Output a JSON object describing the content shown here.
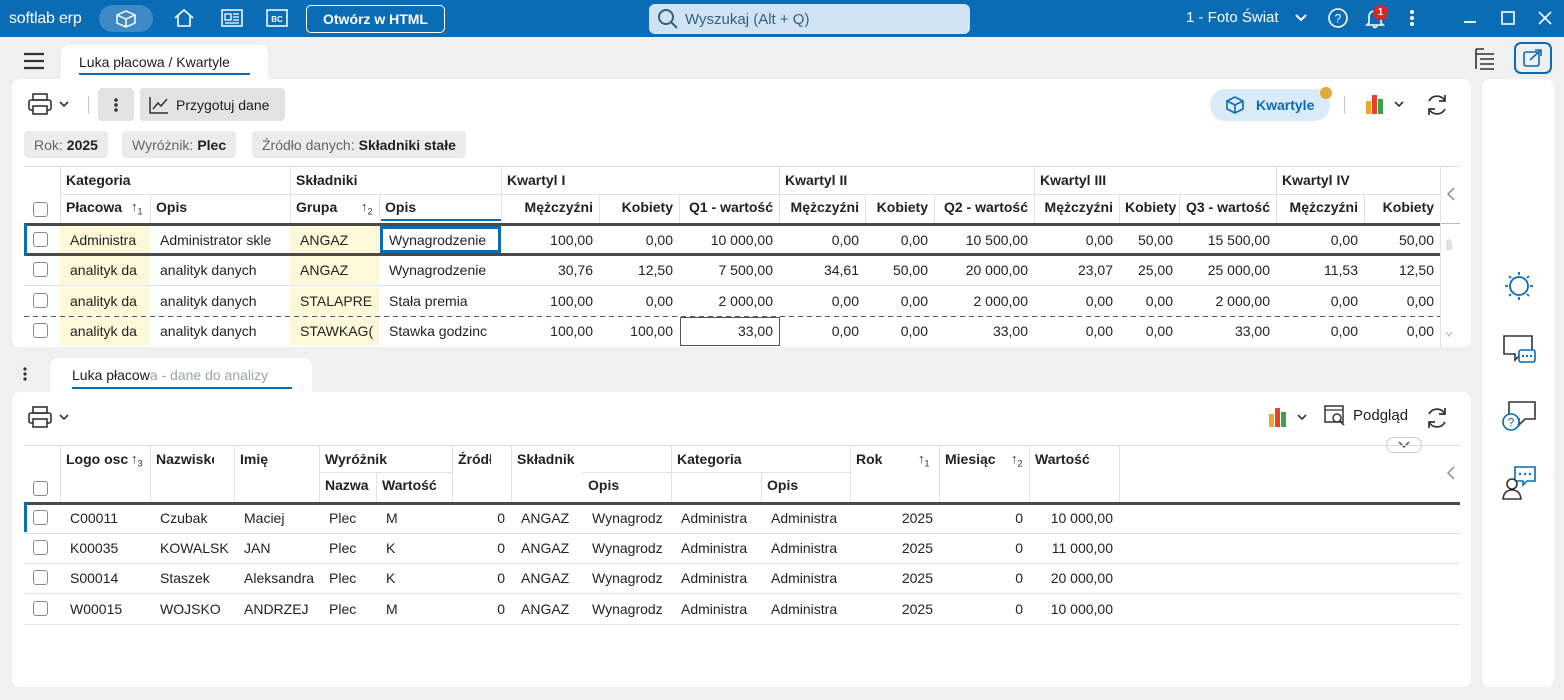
{
  "app": {
    "brand": "softlab erp",
    "open_html_label": "Otwórz w HTML",
    "search_placeholder": "Wyszukaj (Alt + Q)",
    "company": "1 - Foto Świat",
    "notifications_count": "1"
  },
  "tab": {
    "title": "Luka płacowa / Kwartyle"
  },
  "toolbar": {
    "prepare_label": "Przygotuj dane",
    "quartiles_label": "Kwartyle"
  },
  "filters": [
    {
      "label": "Rok:",
      "value": "2025"
    },
    {
      "label": "Wyróżnik:",
      "value": "Plec"
    },
    {
      "label": "Źródło danych:",
      "value": "Składniki stałe"
    }
  ],
  "grid1": {
    "groups": [
      "Kategoria",
      "Składniki",
      "Kwartyl I",
      "Kwartyl II",
      "Kwartyl III",
      "Kwartyl IV"
    ],
    "columns": [
      "Płacowa",
      "Opis",
      "Grupa",
      "Opis",
      "Mężczyźni",
      "Kobiety",
      "Q1 - wartość",
      "Mężczyźni",
      "Kobiety",
      "Q2 - wartość",
      "Mężczyźni",
      "Kobiety",
      "Q3 - wartość",
      "Mężczyźni",
      "Kobiety"
    ],
    "rows": [
      [
        "Administra",
        "Administrator skle",
        "ANGAZ",
        "Wynagrodzenie",
        "100,00",
        "0,00",
        "10 000,00",
        "0,00",
        "0,00",
        "10 500,00",
        "0,00",
        "50,00",
        "15 500,00",
        "0,00",
        "50,00"
      ],
      [
        "analityk da",
        "analityk danych",
        "ANGAZ",
        "Wynagrodzenie",
        "30,76",
        "12,50",
        "7 500,00",
        "34,61",
        "50,00",
        "20 000,00",
        "23,07",
        "25,00",
        "25 000,00",
        "11,53",
        "12,50"
      ],
      [
        "analityk da",
        "analityk danych",
        "STALAPRE",
        "Stała premia",
        "100,00",
        "0,00",
        "2 000,00",
        "0,00",
        "0,00",
        "2 000,00",
        "0,00",
        "0,00",
        "2 000,00",
        "0,00",
        "0,00"
      ],
      [
        "analityk da",
        "analityk danych",
        "STAWKAG(",
        "Stawka godzinc",
        "100,00",
        "100,00",
        "33,00",
        "0,00",
        "0,00",
        "33,00",
        "0,00",
        "0,00",
        "33,00",
        "0,00",
        "0,00"
      ]
    ]
  },
  "panel2": {
    "tab_visible": "Luka płacow",
    "tab_faded": "a - dane do analizy",
    "preview_label": "Podgląd"
  },
  "grid2": {
    "columns": [
      "Logo osc",
      "Nazwisko",
      "Imię",
      "Wyróżnik",
      "Źródło",
      "Składnik",
      "Kategoria",
      "Rok",
      "Miesiąc",
      "Wartość"
    ],
    "subcolumns": [
      "Nazwa",
      "Wartość",
      "Opis",
      "Opis"
    ],
    "rows": [
      [
        "C00011",
        "Czubak",
        "Maciej",
        "Plec",
        "M",
        "0",
        "ANGAZ",
        "Wynagrodz",
        "Administra",
        "Administra",
        "2025",
        "0",
        "10 000,00"
      ],
      [
        "K00035",
        "KOWALSK",
        "JAN",
        "Plec",
        "K",
        "0",
        "ANGAZ",
        "Wynagrodz",
        "Administra",
        "Administra",
        "2025",
        "0",
        "11 000,00"
      ],
      [
        "S00014",
        "Staszek",
        "Aleksandra",
        "Plec",
        "K",
        "0",
        "ANGAZ",
        "Wynagrodz",
        "Administra",
        "Administra",
        "2025",
        "0",
        "20 000,00"
      ],
      [
        "W00015",
        "WOJSKO",
        "ANDRZEJ",
        "Plec",
        "M",
        "0",
        "ANGAZ",
        "Wynagrodz",
        "Administra",
        "Administra",
        "2025",
        "0",
        "10 000,00"
      ]
    ]
  },
  "colors": {
    "accent": "#0a6cb4",
    "highlight": "#fdf8d8"
  }
}
